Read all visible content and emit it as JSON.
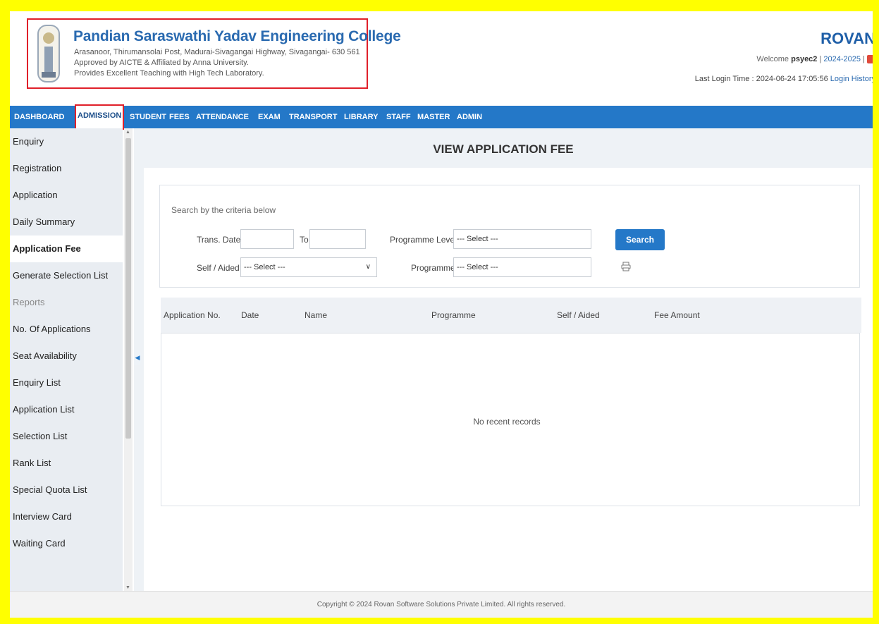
{
  "header": {
    "college_name": "Pandian Saraswathi Yadav Engineering College",
    "address": "Arasanoor, Thirumansolai Post, Madurai-Sivagangai Highway, Sivagangai- 630 561",
    "approval": "Approved by AICTE & Affiliated by Anna University.",
    "tagline": "Provides Excellent Teaching with High Tech Laboratory.",
    "brand": "ROVAN",
    "welcome_label": "Welcome",
    "username": "psyec2",
    "academic_year": "2024-2025",
    "last_login_label": "Last Login Time :",
    "last_login_time": "2024-06-24 17:05:56",
    "login_history": "Login History"
  },
  "nav": {
    "items": [
      "DASHBOARD",
      "ADMISSION",
      "STUDENT",
      "FEES",
      "ATTENDANCE",
      "EXAM",
      "TRANSPORT",
      "LIBRARY",
      "STAFF",
      "MASTER",
      "ADMIN"
    ],
    "active": "ADMISSION"
  },
  "sidebar": {
    "items": [
      {
        "label": "Enquiry"
      },
      {
        "label": "Registration"
      },
      {
        "label": "Application"
      },
      {
        "label": "Daily Summary"
      },
      {
        "label": "Application Fee"
      },
      {
        "label": "Generate Selection List"
      },
      {
        "label": "Reports"
      },
      {
        "label": "No. Of Applications"
      },
      {
        "label": "Seat Availability"
      },
      {
        "label": "Enquiry List"
      },
      {
        "label": "Application List"
      },
      {
        "label": "Selection List"
      },
      {
        "label": "Rank List"
      },
      {
        "label": "Special Quota List"
      },
      {
        "label": "Interview Card"
      },
      {
        "label": "Waiting Card"
      }
    ],
    "active": "Application Fee"
  },
  "main": {
    "title": "VIEW APPLICATION FEE",
    "search_hint": "Search by the criteria below",
    "trans_date_label": "Trans. Date",
    "to_label": "To",
    "trans_date_from": "",
    "trans_date_to": "",
    "programme_level_label": "Programme Level",
    "programme_level_value": "--- Select ---",
    "self_aided_label": "Self / Aided",
    "self_aided_value": "--- Select ---",
    "programme_label": "Programme",
    "programme_value": "--- Select ---",
    "search_button": "Search",
    "table_columns": [
      "Application No.",
      "Date",
      "Name",
      "Programme",
      "Self / Aided",
      "Fee Amount"
    ],
    "empty_message": "No recent records"
  },
  "footer": {
    "copyright": "Copyright © 2024 Rovan Software Solutions Private Limited. All rights reserved."
  }
}
